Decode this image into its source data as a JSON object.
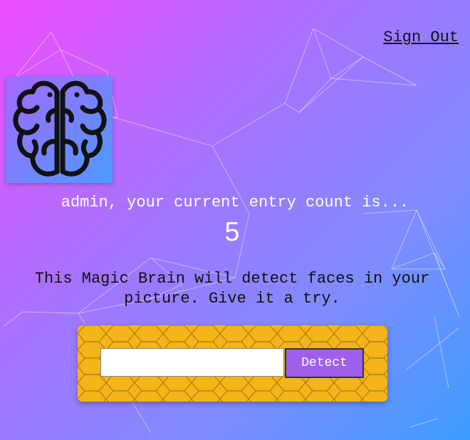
{
  "nav": {
    "signout_label": "Sign Out"
  },
  "logo": {
    "icon": "brain-icon"
  },
  "rank": {
    "user_line": "admin, your current entry count is...",
    "count": "5"
  },
  "description": "This Magic Brain will detect faces in your picture. Give it a try.",
  "form": {
    "input_value": "",
    "input_placeholder": "",
    "detect_label": "Detect"
  },
  "colors": {
    "gradient_start": "#ee4dfc",
    "gradient_end": "#3c9cff",
    "panel": "#f4b41a",
    "button": "#9f5fea"
  }
}
